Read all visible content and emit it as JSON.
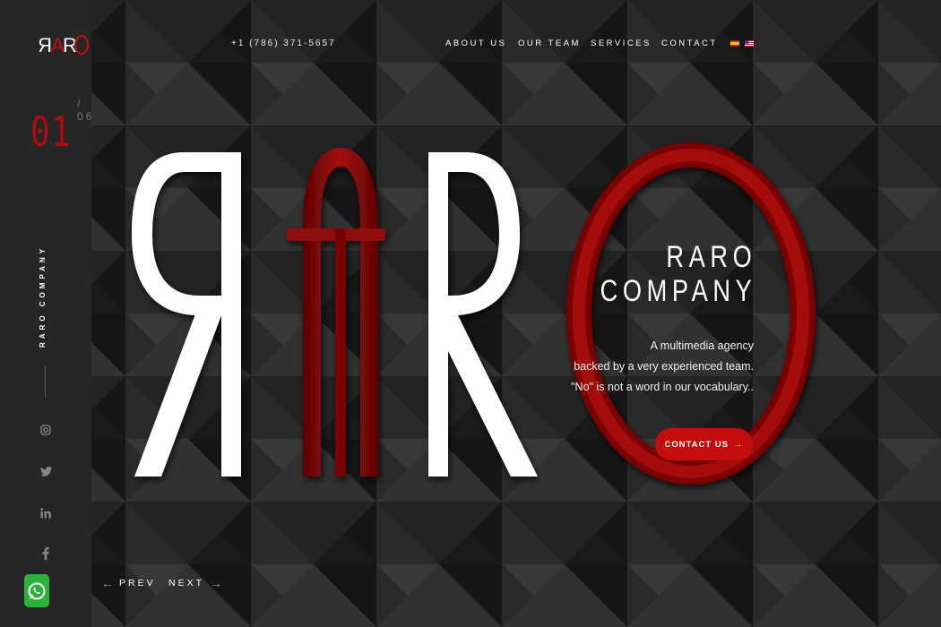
{
  "brand": {
    "logo_text": "RARO",
    "vertical_label": "RARO COMPANY"
  },
  "slider": {
    "current": "01",
    "total": "/ 06",
    "prev_label": "PREV",
    "next_label": "NEXT"
  },
  "header": {
    "phone": "+1 (786) 371-5657",
    "nav": [
      "ABOUT US",
      "OUR TEAM",
      "SERVICES",
      "CONTACT"
    ],
    "languages": [
      "es-flag-icon",
      "us-flag-icon"
    ]
  },
  "hero": {
    "title_line1": "RARO",
    "title_line2": "COMPANY",
    "tagline": [
      "A multimedia agency",
      "backed by a very experienced team.",
      "\"No\" is not a word in our vocabulary.."
    ],
    "cta_label": "CONTACT US"
  },
  "social": [
    "instagram-icon",
    "twitter-icon",
    "linkedin-icon",
    "facebook-icon"
  ],
  "colors": {
    "accent": "#c40e0e",
    "dark_red": "#8e0808",
    "sidebar": "#262626",
    "whatsapp": "#29b23a"
  }
}
